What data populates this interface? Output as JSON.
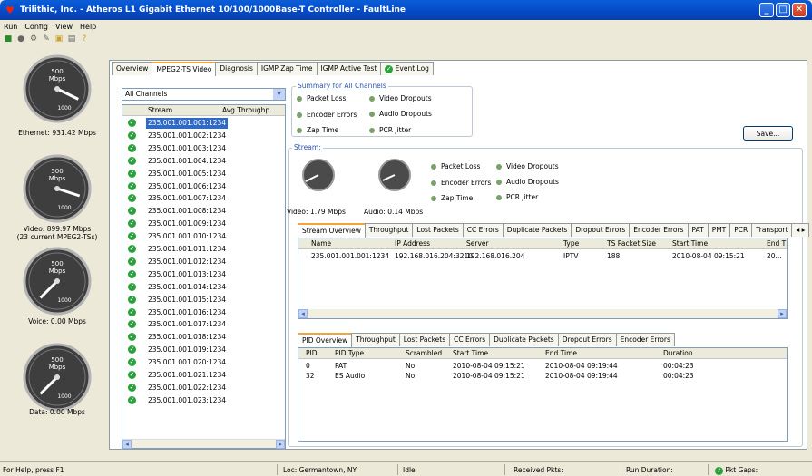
{
  "window": {
    "title": "Trilithic, Inc. - Atheros L1 Gigabit Ethernet 10/100/1000Base-T Controller - FaultLine"
  },
  "menu": [
    "Run",
    "Config",
    "View",
    "Help"
  ],
  "gauges": [
    {
      "unit": "Mbps",
      "max": "500",
      "scale": "1000",
      "caption": "Ethernet: 931.42 Mbps",
      "level": 0.93
    },
    {
      "unit": "Mbps",
      "max": "500",
      "scale": "1000",
      "caption": "Video: 899.97 Mbps\n(23 current MPEG2-TSs)",
      "level": 0.9
    },
    {
      "unit": "Mbps",
      "max": "500",
      "scale": "1000",
      "caption": "Voice: 0.00 Mbps",
      "level": 0.0
    },
    {
      "unit": "Mbps",
      "max": "500",
      "scale": "1000",
      "caption": "Data: 0.00 Mbps",
      "level": 0.0
    }
  ],
  "tabs": [
    "Overview",
    "MPEG2-TS Video",
    "Diagnosis",
    "IGMP Zap Time",
    "IGMP Active Test",
    "Event Log"
  ],
  "channel_filter": "All Channels",
  "stream_list": {
    "columns": [
      "Stream",
      "Avg Throughp..."
    ],
    "rows": [
      "235.001.001.001:1234",
      "235.001.001.002:1234",
      "235.001.001.003:1234",
      "235.001.001.004:1234",
      "235.001.001.005:1234",
      "235.001.001.006:1234",
      "235.001.001.007:1234",
      "235.001.001.008:1234",
      "235.001.001.009:1234",
      "235.001.001.010:1234",
      "235.001.001.011:1234",
      "235.001.001.012:1234",
      "235.001.001.013:1234",
      "235.001.001.014:1234",
      "235.001.001.015:1234",
      "235.001.001.016:1234",
      "235.001.001.017:1234",
      "235.001.001.018:1234",
      "235.001.001.019:1234",
      "235.001.001.020:1234",
      "235.001.001.021:1234",
      "235.001.001.022:1234",
      "235.001.001.023:1234"
    ]
  },
  "summary": {
    "label": "Summary for All Channels",
    "items": [
      "Packet Loss",
      "Video Dropouts",
      "Encoder Errors",
      "Audio Dropouts",
      "Zap Time",
      "PCR Jitter"
    ]
  },
  "save_label": "Save...",
  "stream_group": {
    "label": "Stream:",
    "video": "Video: 1.79 Mbps",
    "audio": "Audio: 0.14 Mbps",
    "items": [
      "Packet Loss",
      "Video Dropouts",
      "Encoder Errors",
      "Audio Dropouts",
      "Zap Time",
      "PCR Jitter"
    ]
  },
  "stream_tabs": [
    "Stream Overview",
    "Throughput",
    "Lost Packets",
    "CC Errors",
    "Duplicate Packets",
    "Dropout Errors",
    "Encoder Errors",
    "PAT",
    "PMT",
    "PCR",
    "Transport"
  ],
  "stream_table": {
    "columns": [
      "Name",
      "IP Address",
      "Server",
      "Type",
      "TS Packet Size",
      "Start Time",
      "End T"
    ],
    "rows": [
      [
        "235.001.001.001:1234",
        "192.168.016.204:3210",
        "192.168.016.204",
        "IPTV",
        "188",
        "2010-08-04  09:15:21",
        "20..."
      ]
    ]
  },
  "pid_tabs": [
    "PID Overview",
    "Throughput",
    "Lost Packets",
    "CC Errors",
    "Duplicate Packets",
    "Dropout Errors",
    "Encoder Errors"
  ],
  "pid_table": {
    "columns": [
      "PID",
      "PID Type",
      "Scrambled",
      "Start Time",
      "End Time",
      "Duration"
    ],
    "rows": [
      [
        "0",
        "PAT",
        "No",
        "2010-08-04  09:15:21",
        "2010-08-04  09:19:44",
        "00:04:23"
      ],
      [
        "32",
        "ES Audio",
        "No",
        "2010-08-04  09:15:21",
        "2010-08-04  09:19:44",
        "00:04:23"
      ]
    ]
  },
  "status": {
    "help": "For Help, press F1",
    "loc": "Loc: Germantown, NY",
    "state": "Idle",
    "received": "Received Pkts:",
    "duration": "Run Duration:",
    "gaps": "Pkt Gaps:"
  }
}
